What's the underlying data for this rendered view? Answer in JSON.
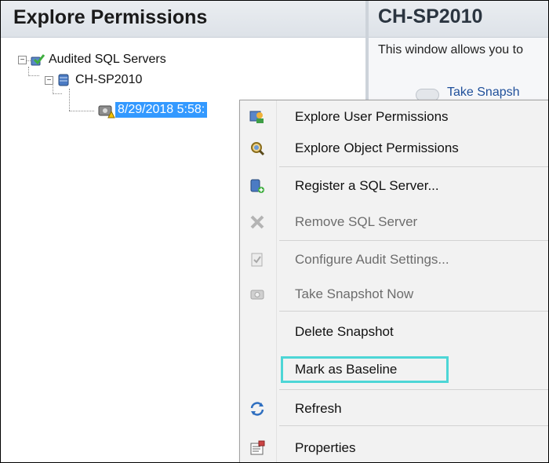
{
  "left_panel": {
    "title": "Explore Permissions",
    "tree": {
      "root_label": "Audited SQL Servers",
      "server_label": "CH-SP2010",
      "snapshot_label": "8/29/2018 5:58:"
    }
  },
  "right_panel": {
    "title": "CH-SP2010",
    "description": "This window allows you to",
    "link_fragment": "Take Snapsh"
  },
  "context_menu": {
    "items": [
      {
        "label": "Explore User Permissions",
        "icon": "user-permissions-icon",
        "enabled": true
      },
      {
        "label": "Explore Object Permissions",
        "icon": "object-permissions-icon",
        "enabled": true
      },
      {
        "label": "Register a SQL Server...",
        "icon": "register-server-icon",
        "enabled": true
      },
      {
        "label": "Remove SQL Server",
        "icon": "remove-icon",
        "enabled": false
      },
      {
        "label": "Configure Audit Settings...",
        "icon": "configure-icon",
        "enabled": false
      },
      {
        "label": "Take Snapshot Now",
        "icon": "camera-icon",
        "enabled": false
      },
      {
        "label": "Delete Snapshot",
        "icon": "",
        "enabled": true
      },
      {
        "label": "Mark as Baseline",
        "icon": "",
        "enabled": true
      },
      {
        "label": "Refresh",
        "icon": "refresh-icon",
        "enabled": true
      },
      {
        "label": "Properties",
        "icon": "properties-icon",
        "enabled": true
      }
    ],
    "highlighted_item": "Mark as Baseline",
    "highlight_color": "#4dd6d6",
    "selection_color": "#3399ff"
  }
}
